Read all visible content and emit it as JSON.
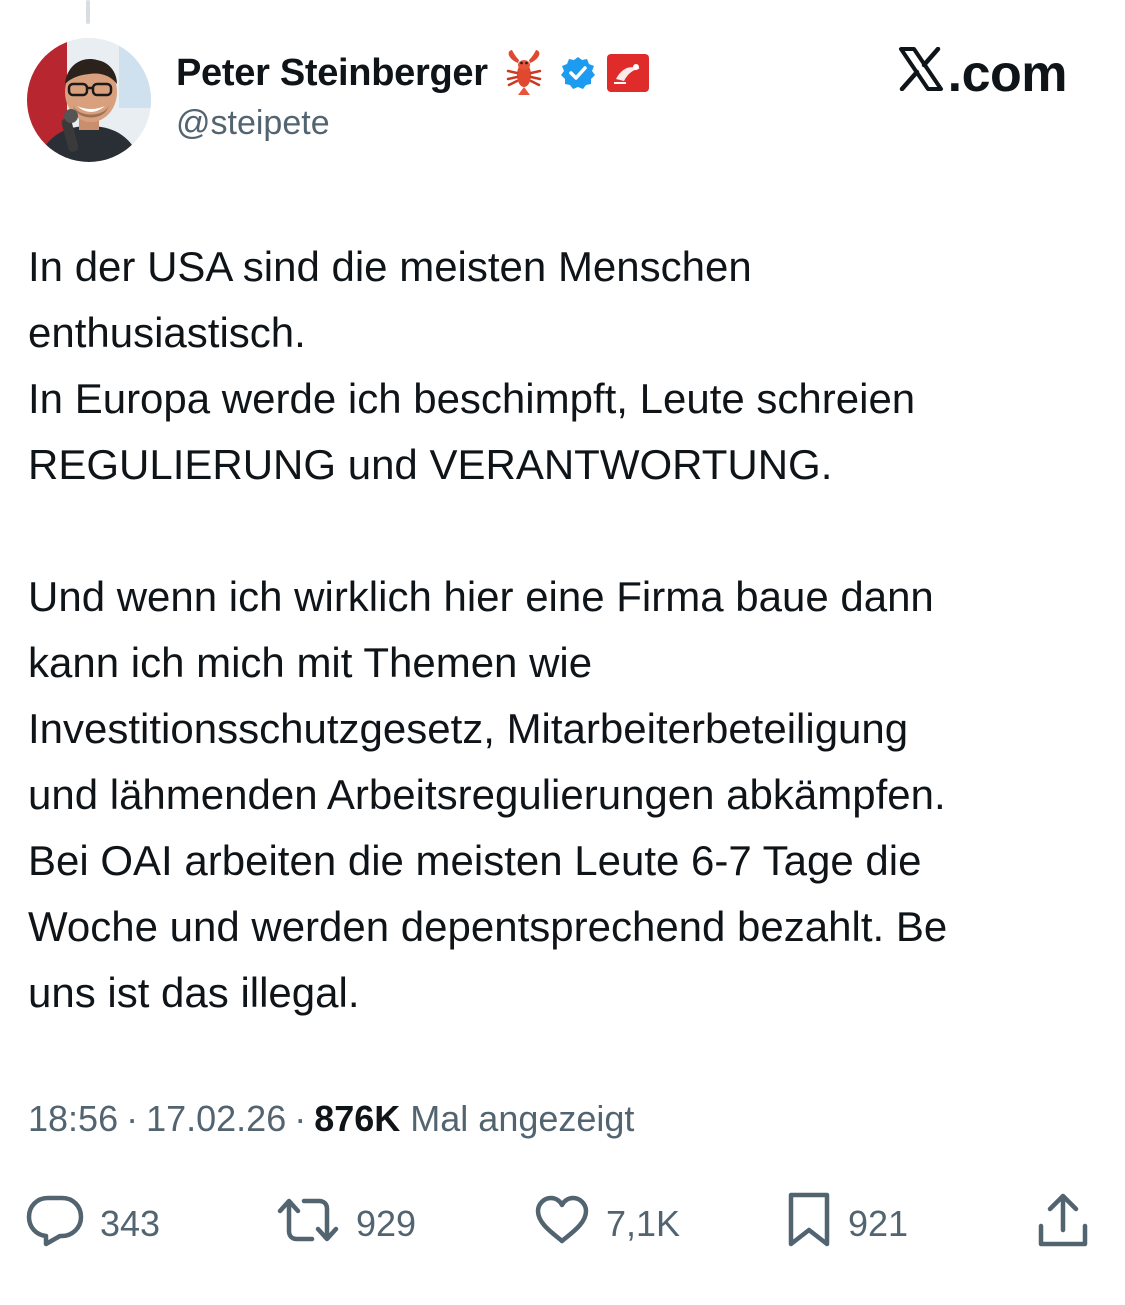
{
  "author": {
    "display_name": "Peter Steinberger",
    "handle": "@steipete",
    "badges": [
      "lobster-emoji-icon",
      "verified-badge-icon",
      "affiliate-badge-icon"
    ],
    "verified_color": "#1d9bf0"
  },
  "site_label": {
    "text": ".com",
    "icon": "x-logo-icon"
  },
  "tweet": {
    "paragraphs": [
      [
        "In der USA sind die meisten Menschen",
        "enthusiastisch.",
        "In Europa werde ich beschimpft, Leute schreien",
        "REGULIERUNG und VERANTWORTUNG."
      ],
      [
        "Und wenn ich wirklich hier eine Firma baue dann",
        "kann ich mich mit Themen wie",
        "Investitionsschutzgesetz, Mitarbeiterbeteiligung",
        "und lähmenden Arbeitsregulierungen abkämpfen.",
        "Bei OAI arbeiten die meisten Leute 6-7 Tage die",
        "Woche und werden depentsprechend bezahlt. Be",
        "uns ist das illegal."
      ]
    ]
  },
  "meta": {
    "time": "18:56",
    "separator": "·",
    "date": "17.02.26",
    "views_count": "876K",
    "views_label": "Mal angezeigt"
  },
  "actions": {
    "replies": "343",
    "reposts": "929",
    "likes": "7,1K",
    "bookmarks": "921"
  },
  "colors": {
    "text_primary": "#0f1419",
    "text_secondary": "#536471",
    "background": "#ffffff"
  }
}
